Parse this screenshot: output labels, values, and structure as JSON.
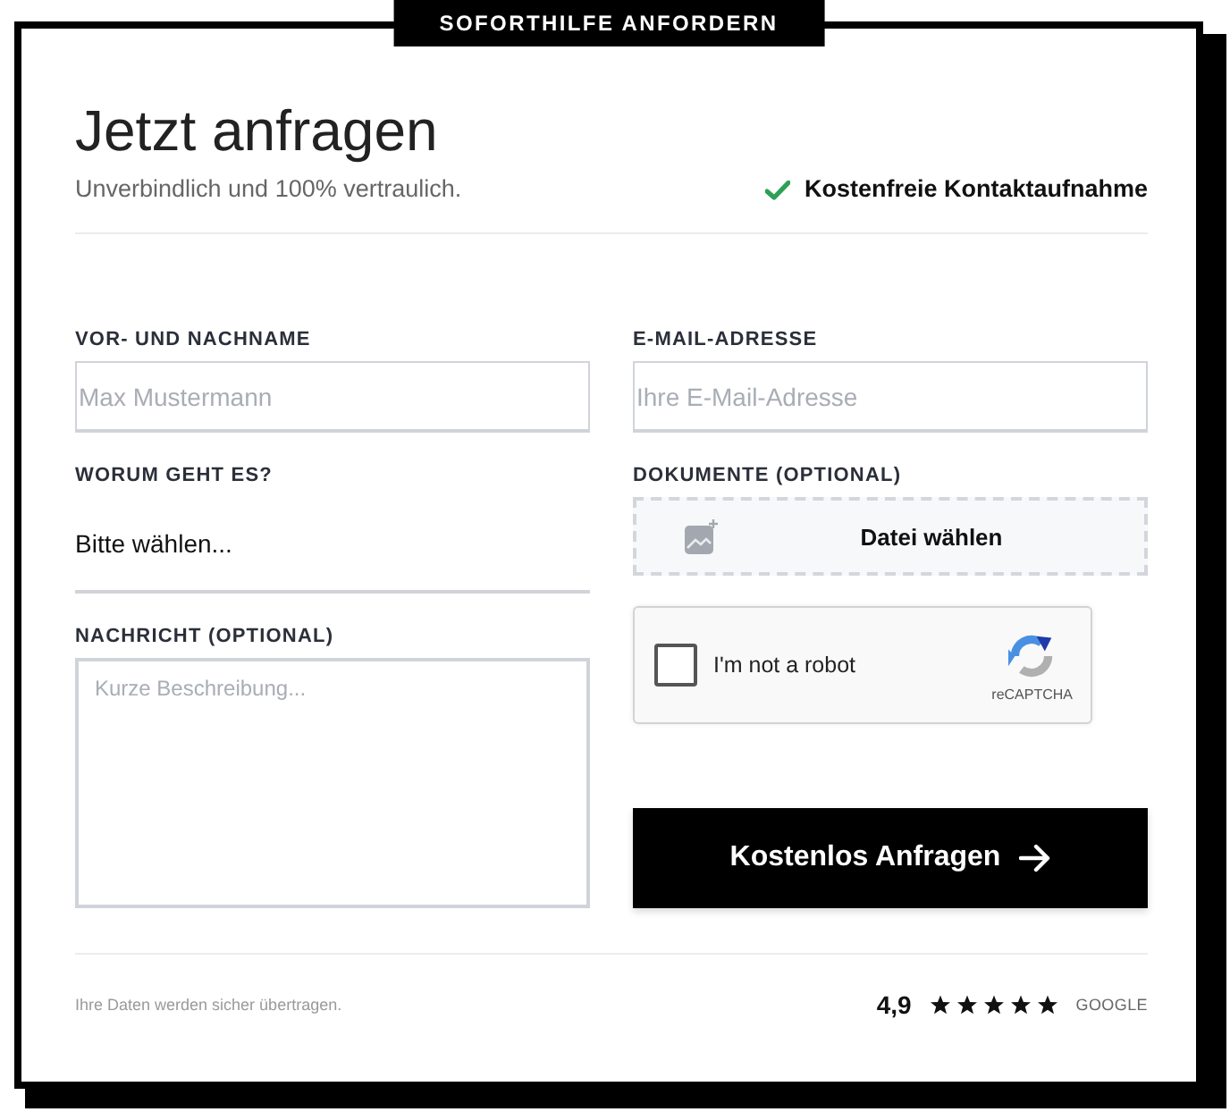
{
  "badge": {
    "label": "SOFORTHILFE ANFORDERN"
  },
  "header": {
    "title": "Jetzt anfragen",
    "subtitle": "Unverbindlich und 100% vertraulich.",
    "highlight": "Kostenfreie Kontaktaufnahme"
  },
  "form": {
    "columns": [
      {
        "fields": [
          {
            "kind": "text",
            "label": "VOR- UND NACHNAME",
            "placeholder": "Max Mustermann"
          },
          {
            "kind": "select",
            "label": "WORUM GEHT ES?",
            "value": "Bitte wählen..."
          },
          {
            "kind": "textarea",
            "label": "NACHRICHT (OPTIONAL)",
            "placeholder": "Kurze Beschreibung..."
          }
        ]
      },
      {
        "fields": [
          {
            "kind": "email",
            "label": "E-MAIL-ADRESSE",
            "placeholder": "Ihre E-Mail-Adresse"
          },
          {
            "kind": "upload",
            "label": "DOKUMENTE (OPTIONAL)",
            "button": "Datei wählen"
          },
          {
            "kind": "captcha",
            "text": "I'm not a robot",
            "checked": false,
            "brand": "reCAPTCHA"
          },
          {
            "kind": "submit",
            "text": "Kostenlos Anfragen"
          }
        ]
      }
    ]
  },
  "footer": {
    "note": "Ihre Daten werden sicher übertragen.",
    "rating": "4,9",
    "stars": 5,
    "source": "GOOGLE"
  }
}
